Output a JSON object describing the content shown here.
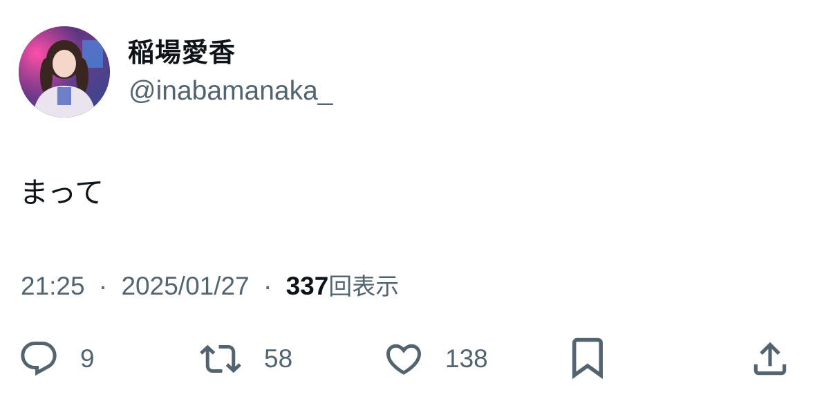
{
  "user": {
    "display_name": "稲場愛香",
    "handle": "@inabamanaka_"
  },
  "tweet": {
    "text": "まって",
    "time": "21:25",
    "date": "2025/01/27",
    "separator": "·",
    "views_count": "337",
    "views_label": "回表示"
  },
  "actions": {
    "reply_count": "9",
    "retweet_count": "58",
    "like_count": "138"
  },
  "icons": {
    "reply": "reply-icon",
    "retweet": "retweet-icon",
    "like": "heart-icon",
    "bookmark": "bookmark-icon",
    "share": "share-icon"
  },
  "colors": {
    "text_primary": "#0f1419",
    "text_secondary": "#536471",
    "background": "#ffffff"
  }
}
